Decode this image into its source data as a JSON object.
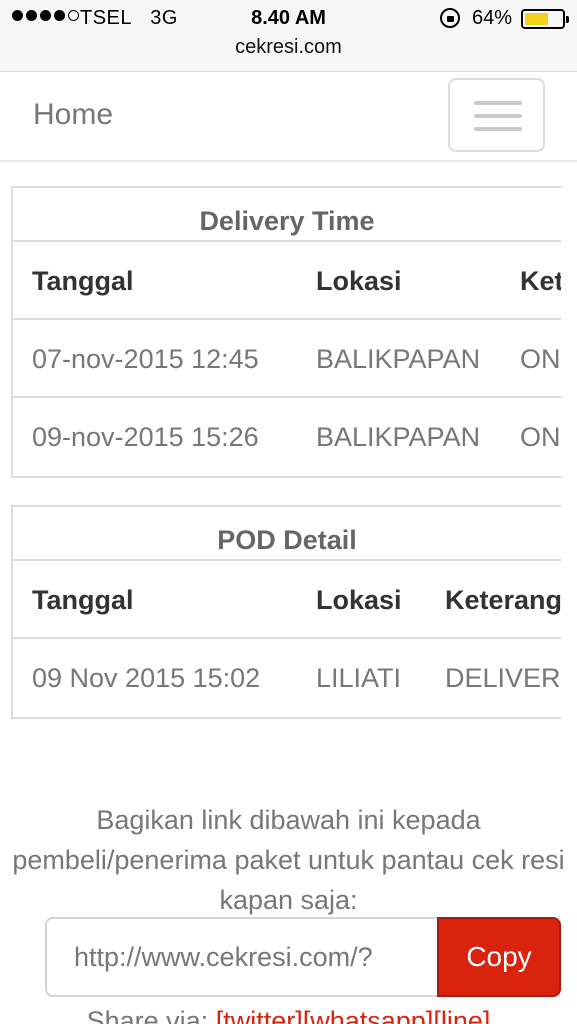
{
  "status_bar": {
    "carrier": "TSEL",
    "network": "3G",
    "time": "8.40 AM",
    "battery_percent": "64%",
    "battery_level": 0.64,
    "url": "cekresi.com"
  },
  "navbar": {
    "brand": "Home",
    "menu_icon": "hamburger-menu-icon"
  },
  "delivery_time": {
    "title": "Delivery Time",
    "columns": [
      "Tanggal",
      "Lokasi",
      "Keterangan"
    ],
    "rows": [
      [
        "07-nov-2015 12:45",
        "BALIKPAPAN",
        "ON PROCESS"
      ],
      [
        "09-nov-2015 15:26",
        "BALIKPAPAN",
        "ON PROCESS"
      ]
    ]
  },
  "pod_detail": {
    "title": "POD Detail",
    "columns": [
      "Tanggal",
      "Lokasi",
      "Keterangan"
    ],
    "rows": [
      [
        "09 Nov 2015 15:02",
        "LILIATI",
        "DELIVERED"
      ]
    ]
  },
  "share": {
    "instruction": "Bagikan link dibawah ini kepada pembeli/penerima paket untuk pantau cek resi kapan saja:",
    "link_value": "http://www.cekresi.com/?",
    "copy_label": "Copy",
    "via_label": "Share via:",
    "links": [
      "[twitter]",
      "[whatsapp]",
      "[line]"
    ]
  },
  "colors": {
    "accent": "#d9230f",
    "battery": "#f4d01e"
  }
}
